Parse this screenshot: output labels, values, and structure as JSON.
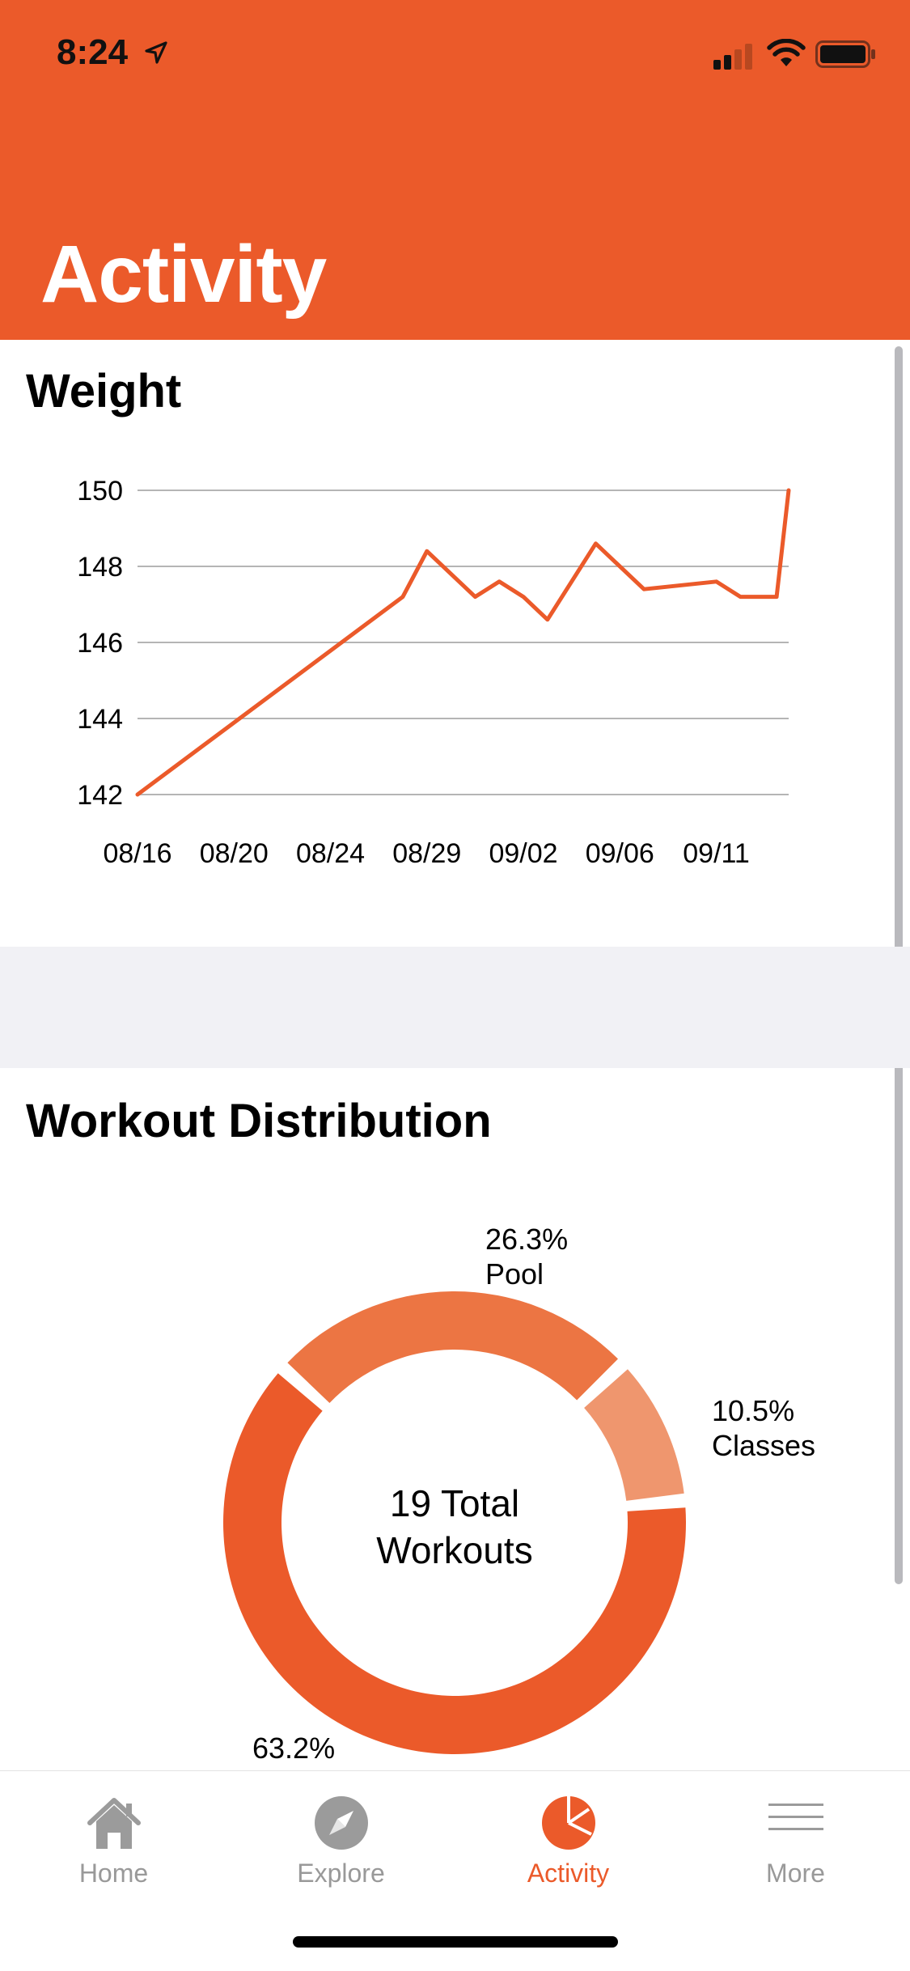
{
  "status_bar": {
    "time": "8:24"
  },
  "header": {
    "title": "Activity"
  },
  "weight_section": {
    "title": "Weight"
  },
  "workout_section": {
    "title": "Workout Distribution"
  },
  "chart_data": [
    {
      "type": "line",
      "x": [
        "08/16",
        "08/27",
        "08/28",
        "08/30",
        "08/31",
        "09/01",
        "09/02",
        "09/03",
        "09/05",
        "09/06",
        "09/08",
        "09/09",
        "09/10",
        "09/11"
      ],
      "x_num": [
        0,
        11,
        12,
        14,
        15,
        16,
        17,
        19,
        21,
        24,
        25,
        26,
        26.5,
        27
      ],
      "series": [
        {
          "values": [
            142.0,
            147.2,
            148.4,
            147.2,
            147.6,
            147.2,
            146.6,
            148.6,
            147.4,
            147.6,
            147.2,
            147.2,
            147.2,
            150.0
          ]
        }
      ],
      "ylim": [
        142,
        150
      ],
      "yticks": [
        150,
        148,
        146,
        144,
        142
      ],
      "xticks": [
        "08/16",
        "08/20",
        "08/24",
        "08/29",
        "09/02",
        "09/06",
        "09/11"
      ],
      "xtick_num": [
        0,
        4,
        8,
        12,
        16,
        20,
        24
      ],
      "grid": true,
      "color": "#EB5A2A",
      "title": "",
      "xlabel": "",
      "ylabel": ""
    },
    {
      "type": "pie",
      "categories": [
        "Pool",
        "Classes",
        ""
      ],
      "values": [
        26.3,
        10.5,
        63.2
      ],
      "labels": [
        "26.3%",
        "10.5%",
        "63.2%"
      ],
      "colors": [
        "#EC7543",
        "#EF966E",
        "#EB5A2A"
      ],
      "center_text": [
        "19 Total",
        "Workouts"
      ]
    }
  ],
  "tabs": [
    {
      "label": "Home",
      "icon": "home-icon",
      "active": false
    },
    {
      "label": "Explore",
      "icon": "compass-icon",
      "active": false
    },
    {
      "label": "Activity",
      "icon": "pie-chart-icon",
      "active": true
    },
    {
      "label": "More",
      "icon": "menu-icon",
      "active": false
    }
  ],
  "colors": {
    "accent": "#EB5A2A",
    "inactive_tab": "#999999",
    "band": "#F1F1F5"
  }
}
